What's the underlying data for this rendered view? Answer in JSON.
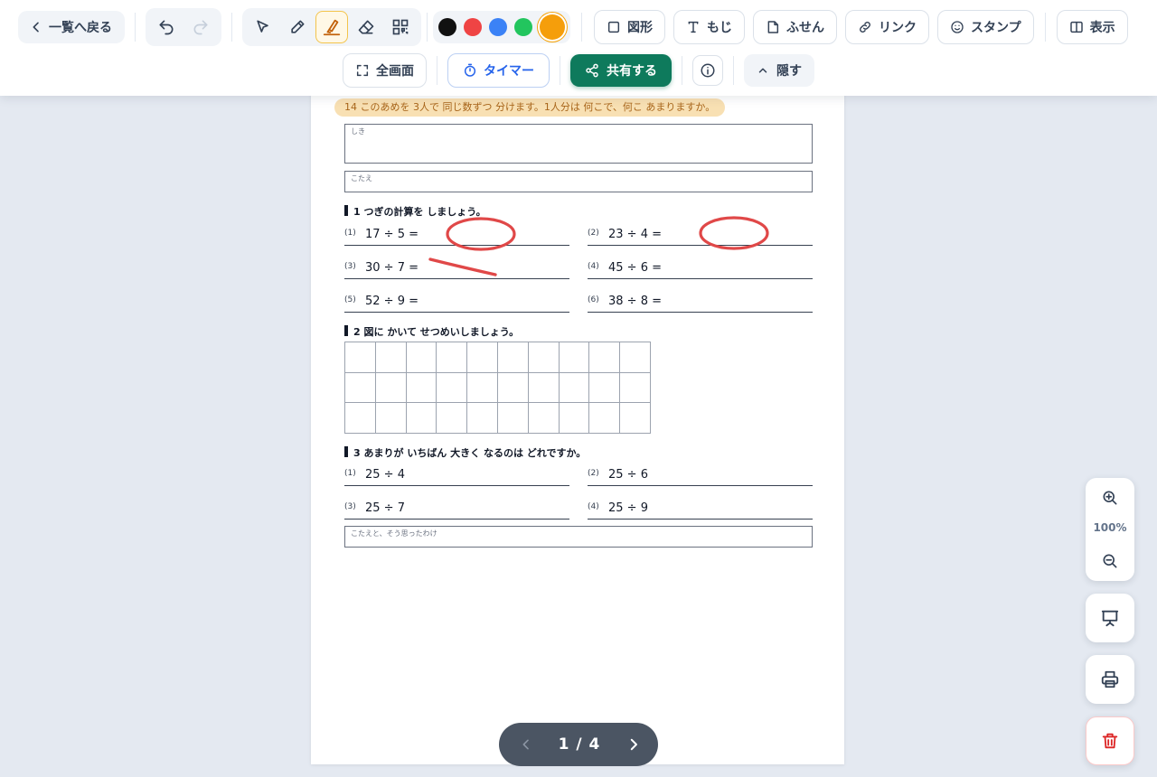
{
  "toolbar": {
    "back_label": "一覧へ戻る",
    "colors": [
      "#111111",
      "#ef4444",
      "#3b82f6",
      "#22c55e",
      "#f59e0b"
    ],
    "selected_color": "#f59e0b",
    "active_tool": "highlighter",
    "tools": [
      "select",
      "pen",
      "highlighter",
      "eraser",
      "qr-code"
    ],
    "shape_label": "図形",
    "text_label": "もじ",
    "sticky_label": "ふせん",
    "link_label": "リンク",
    "stamp_label": "スタンプ",
    "view_label": "表示",
    "fullscreen_label": "全画面",
    "timer_label": "タイマー",
    "share_label": "共有する",
    "hide_label": "隠す"
  },
  "worksheet": {
    "question_14": "14 このあめを 3人で 同じ数ずつ 分けます。1人分は 何こで、何こ あまりますか。",
    "formula_label": "しき",
    "answer_label": "こたえ",
    "section1": {
      "title": "1 つぎの計算を しましょう。",
      "problems": [
        {
          "num": "(1)",
          "expr": "17 ÷ 5 ="
        },
        {
          "num": "(2)",
          "expr": "23 ÷ 4 ="
        },
        {
          "num": "(3)",
          "expr": "30 ÷ 7 ="
        },
        {
          "num": "(4)",
          "expr": "45 ÷ 6 ="
        },
        {
          "num": "(5)",
          "expr": "52 ÷ 9 ="
        },
        {
          "num": "(6)",
          "expr": "38 ÷ 8 ="
        }
      ]
    },
    "section2": {
      "title": "2 図に かいて せつめいしましょう。",
      "grid_rows": 3,
      "grid_cols": 10
    },
    "section3": {
      "title": "3 あまりが いちばん 大きく なるのは どれですか。",
      "problems": [
        {
          "num": "(1)",
          "expr": "25 ÷ 4"
        },
        {
          "num": "(2)",
          "expr": "25 ÷ 6"
        },
        {
          "num": "(3)",
          "expr": "25 ÷ 7"
        },
        {
          "num": "(4)",
          "expr": "25 ÷ 9"
        }
      ],
      "reason_label": "こたえと、そう思ったわけ"
    },
    "ink_color": "#e04848"
  },
  "pagination": {
    "current": "1",
    "separator": "/",
    "total": "4"
  },
  "zoom": {
    "level": "100%"
  }
}
